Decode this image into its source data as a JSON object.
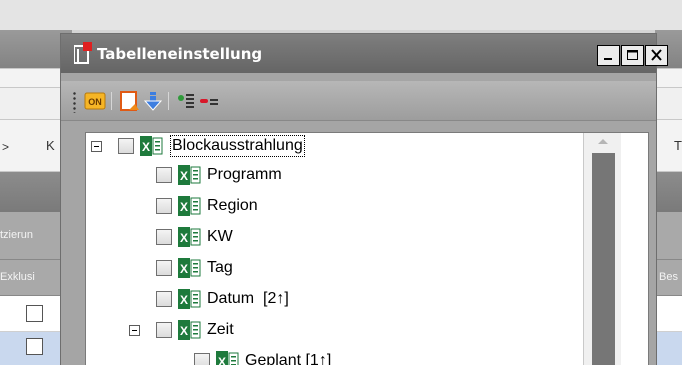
{
  "background": {
    "left_breadcrumb": ">",
    "left_tab_label": "K",
    "left_col_header_1": "tzierun",
    "left_col_header_2": "Exklusi",
    "right_tab_label": "T",
    "right_col_header": "Bes"
  },
  "dialog": {
    "title": "Tabelleneinstellung",
    "window_controls": {
      "minimize": "_",
      "maximize": "☐",
      "close": "✕"
    },
    "toolbar": {
      "buttons": [
        {
          "icon": "on-toggle-icon",
          "label": "ON"
        },
        {
          "icon": "export-document-icon"
        },
        {
          "icon": "download-arrow-icon"
        },
        {
          "icon": "add-column-icon"
        },
        {
          "icon": "remove-column-icon"
        }
      ]
    },
    "tree": {
      "root": {
        "label": "Blockausstrahlung",
        "expanded": true,
        "checked": false
      },
      "children": [
        {
          "label": "Programm",
          "checked": false
        },
        {
          "label": "Region",
          "checked": false
        },
        {
          "label": "KW",
          "checked": false
        },
        {
          "label": "Tag",
          "checked": false
        },
        {
          "label": "Datum  [2↑]",
          "checked": false
        },
        {
          "label": "Zeit",
          "checked": false,
          "expanded": true
        }
      ],
      "grandchildren": [
        {
          "label": "Geplant [1↑]",
          "checked": false
        }
      ]
    }
  },
  "colors": {
    "titlebar": "#6f6f6f",
    "excel_green": "#1e7a3c",
    "scroll_thumb": "#767676"
  }
}
